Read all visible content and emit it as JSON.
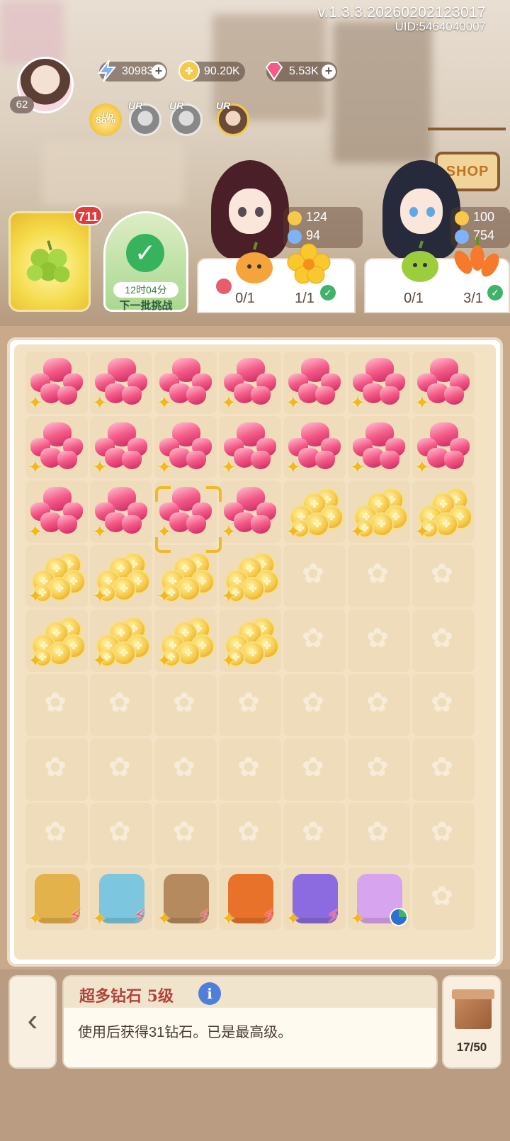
{
  "header": {
    "version": "v.1.3.3.20260202123017",
    "uid": "UID:5464040007",
    "player_level": "62"
  },
  "resources": {
    "energy": "30983",
    "coins": "90.20K",
    "gems": "5.53K"
  },
  "gacha": {
    "up_rate": "88%",
    "up_label": "Up",
    "ur_label": "UR"
  },
  "quests": {
    "grape_badge": "711",
    "challenge_timer": "12时04分",
    "challenge_label": "下一批挑战"
  },
  "shop_label": "SHOP",
  "orders": [
    {
      "coins": "124",
      "butterflies": "94",
      "req1": "0/1",
      "req2": "1/1"
    },
    {
      "coins": "100",
      "butterflies": "754",
      "req1": "0/1",
      "req2": "3/1"
    }
  ],
  "board": {
    "rows": [
      [
        "gem",
        "gem",
        "gem",
        "gem",
        "gem",
        "gem",
        "gem"
      ],
      [
        "gem",
        "gem",
        "gem",
        "gem",
        "gem",
        "gem",
        "gem"
      ],
      [
        "gem",
        "gem",
        "gem",
        "gem",
        "coin",
        "coin",
        "coin"
      ],
      [
        "coin",
        "coin",
        "coin",
        "coin",
        "empty",
        "empty",
        "empty"
      ],
      [
        "coin",
        "coin",
        "coin",
        "coin",
        "empty",
        "empty",
        "empty"
      ],
      [
        "empty",
        "empty",
        "empty",
        "empty",
        "empty",
        "empty",
        "empty"
      ],
      [
        "empty",
        "empty",
        "empty",
        "empty",
        "empty",
        "empty",
        "empty"
      ],
      [
        "empty",
        "empty",
        "empty",
        "empty",
        "empty",
        "empty",
        "empty"
      ],
      [
        "cabinet-generator",
        "greenhouse-generator",
        "garden-generator",
        "teapot-generator",
        "portal-generator",
        "perfume-generator",
        "empty"
      ]
    ]
  },
  "info": {
    "title": "超多钻石 5级",
    "description": "使用后获得31钻石。已是最高级。"
  },
  "inventory": {
    "count": "17/50"
  },
  "colors": {
    "gem": "#f45b88",
    "coin": "#f6c94a",
    "accent_green": "#37b35e",
    "badge_red": "#e23b3b"
  }
}
